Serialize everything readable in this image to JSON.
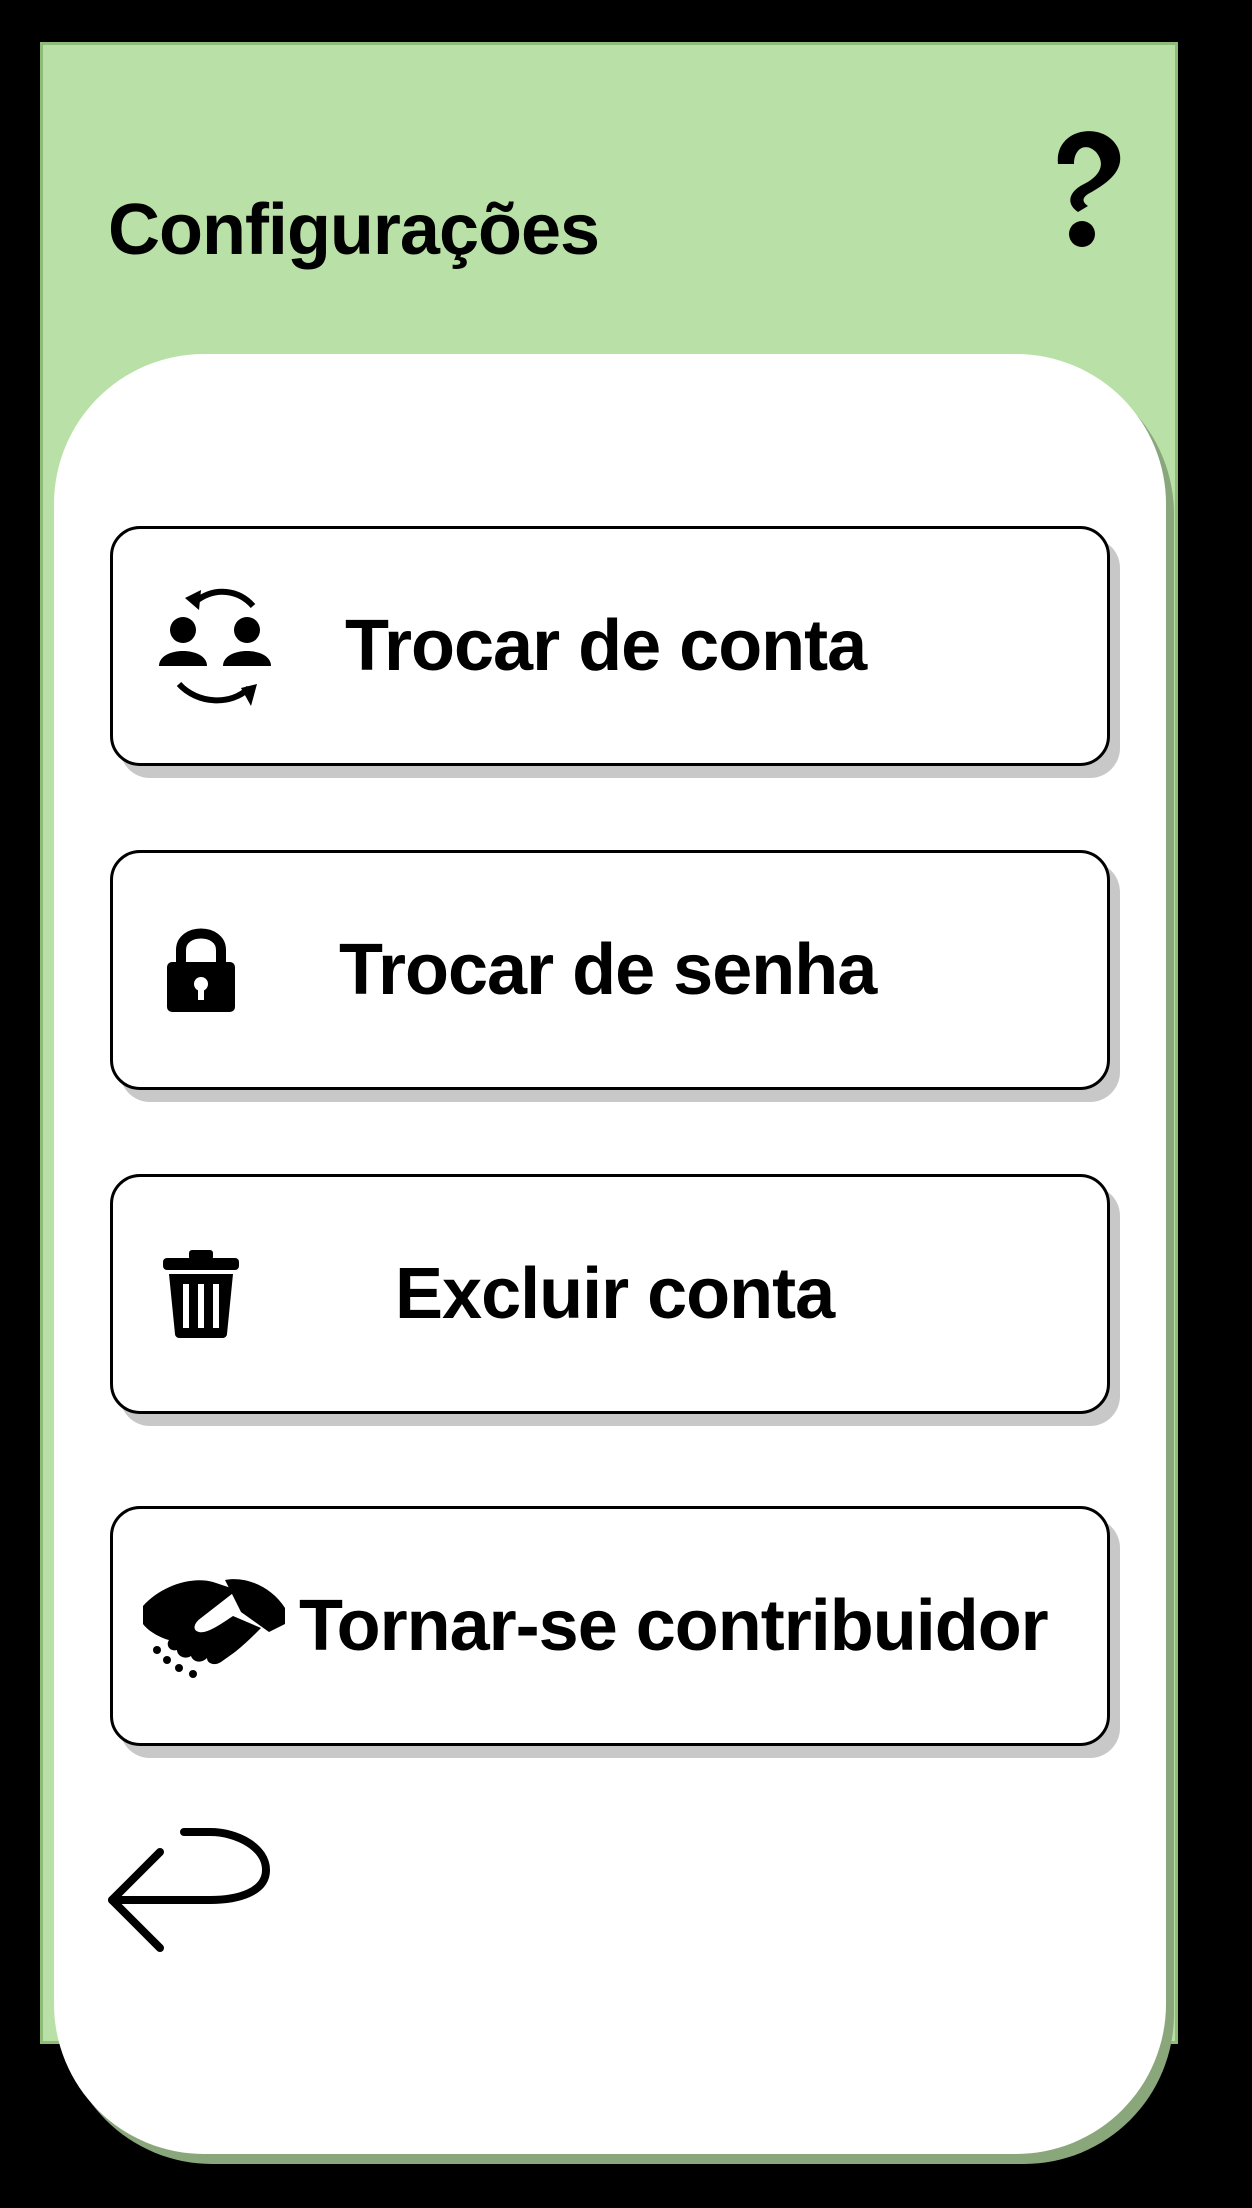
{
  "header": {
    "title": "Configurações",
    "help_icon": "question-mark-icon"
  },
  "menu": {
    "items": [
      {
        "label": "Trocar de conta",
        "icon": "switch-accounts-icon"
      },
      {
        "label": "Trocar de senha",
        "icon": "lock-icon"
      },
      {
        "label": "Excluir conta",
        "icon": "trash-icon"
      },
      {
        "label": "Tornar-se contribuidor",
        "icon": "handshake-icon"
      }
    ]
  },
  "navigation": {
    "back_icon": "back-arrow-icon"
  },
  "colors": {
    "header_background": "#b9e0a7",
    "card_background": "#ffffff",
    "outer_background": "#000000",
    "button_border": "#000000",
    "button_shadow": "#c8c8c8"
  }
}
